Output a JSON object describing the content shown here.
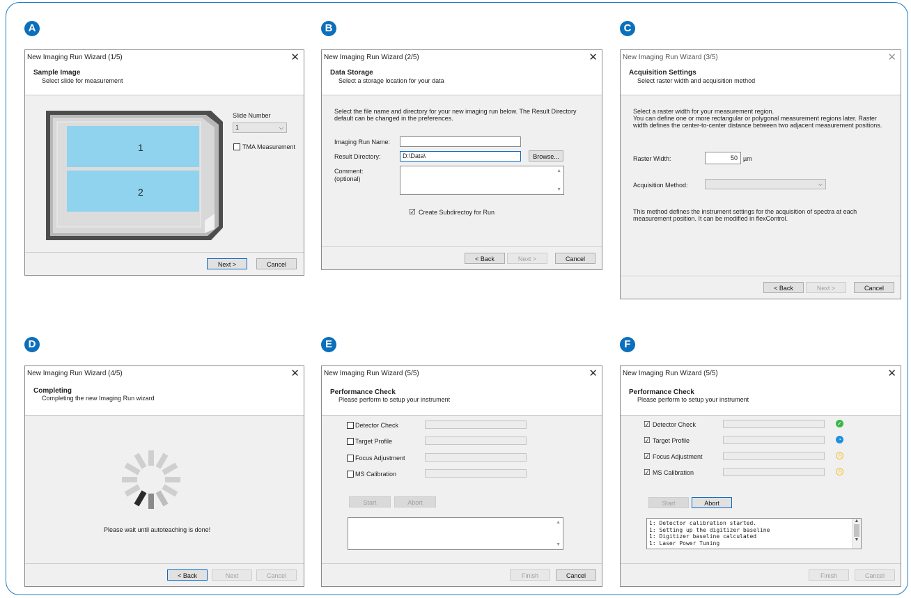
{
  "panels": {
    "a": {
      "badge": "A",
      "title": "New Imaging Run Wizard (1/5)",
      "header_title": "Sample Image",
      "header_subtitle": "Select slide for measurement",
      "slide_number_label": "Slide Number",
      "slide_number_value": "1",
      "tma_label": "TMA Measurement",
      "region_1": "1",
      "region_2": "2",
      "next": "Next >",
      "cancel": "Cancel"
    },
    "b": {
      "badge": "B",
      "title": "New Imaging Run Wizard (2/5)",
      "header_title": "Data Storage",
      "header_subtitle": "Select a storage location for your data",
      "intro_line1": "Select the file name and directory for your new imaging run below. The Result Directory",
      "intro_line2": "default can be changed in the preferences.",
      "run_name_label": "Imaging Run Name:",
      "run_name_value": "",
      "result_dir_label": "Result Directory:",
      "result_dir_value": "D:\\Data\\",
      "browse": "Browse...",
      "comment_label": "Comment:",
      "comment_optional": "(optional)",
      "subdir_label": "Create Subdirectoy for Run",
      "subdir_checked": "☑",
      "back": "< Back",
      "next": "Next >",
      "cancel": "Cancel"
    },
    "c": {
      "badge": "C",
      "title": "New Imaging Run Wizard (3/5)",
      "header_title": "Acquisition Settings",
      "header_subtitle": "Select raster width and acquisition method",
      "intro_line1": "Select a raster width for your measurement region.",
      "intro_line2": "You can define one or more rectangular or polygonal measurement regions later. Raster",
      "intro_line3": "width defines the center-to-center distance between two adjacent measurement positions.",
      "raster_label": "Raster Width:",
      "raster_value": "50",
      "raster_unit": "µm",
      "method_label": "Acquisition Method:",
      "method_value": "",
      "note_line1": "This method defines the instrument settings for the acquisition of spectra at each",
      "note_line2": "measurement position. It can be modified in flexControl.",
      "back": "< Back",
      "next": "Next >",
      "cancel": "Cancel"
    },
    "d": {
      "badge": "D",
      "title": "New Imaging Run Wizard (4/5)",
      "header_title": "Completing",
      "header_subtitle": "Completing the new Imaging Run wizard",
      "wait_text": "Please wait until autoteaching is done!",
      "back": "< Back",
      "next": "Next",
      "cancel": "Cancel"
    },
    "e": {
      "badge": "E",
      "title": "New Imaging Run Wizard (5/5)",
      "header_title": "Performance Check",
      "header_subtitle": "Please perform to setup your instrument",
      "checks": [
        "Detector Check",
        "Target Profile",
        "Focus Adjustment",
        "MS Calibration"
      ],
      "start": "Start",
      "abort": "Abort",
      "finish": "Finish",
      "cancel": "Cancel"
    },
    "f": {
      "badge": "F",
      "title": "New Imaging Run Wizard (5/5)",
      "header_title": "Performance Check",
      "header_subtitle": "Please perform to setup your instrument",
      "checks": [
        "Detector Check",
        "Target Profile",
        "Focus Adjustment",
        "MS Calibration"
      ],
      "check_mark": "☑",
      "start": "Start",
      "abort": "Abort",
      "log": [
        "1: Detector calibration started.",
        "1: Setting up the digitizer baseline",
        "1: Digitizer baseline calculated",
        "1: Laser Power Tuning"
      ],
      "finish": "Finish",
      "cancel": "Cancel",
      "status_icons": [
        "check-circle-icon",
        "progress-circle-icon",
        "clock-icon",
        "clock-icon"
      ],
      "status_colors": [
        "#3cb54a",
        "#1e90e0",
        "#f2c230",
        "#f2c230"
      ]
    }
  },
  "colors": {
    "accent": "#0b6fbb",
    "slide_region": "#8fd3ee"
  }
}
